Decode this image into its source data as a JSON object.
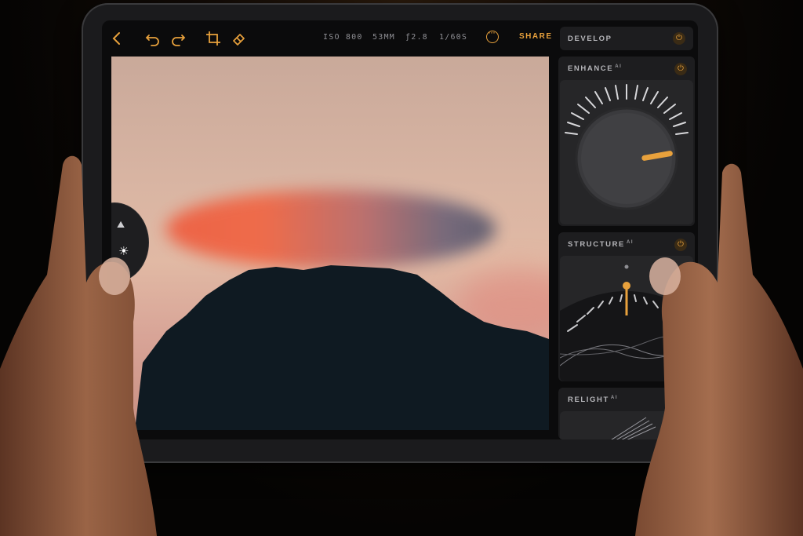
{
  "toolbar": {
    "back_icon": "chevron-left-icon",
    "undo_icon": "undo-icon",
    "redo_icon": "redo-icon",
    "crop_icon": "crop-icon",
    "eraser_icon": "eraser-icon",
    "iso": "ISO 800",
    "focal": "53MM",
    "aperture": "ƒ2.8",
    "shutter": "1/60S",
    "more_icon": "more-icon",
    "share_label": "SHARE"
  },
  "panel": {
    "develop_label": "DEVELOP",
    "cards": [
      {
        "title": "ENHANCE",
        "badge": "AI"
      },
      {
        "title": "STRUCTURE",
        "badge": "AI"
      },
      {
        "title": "RELIGHT",
        "badge": "AI"
      }
    ]
  },
  "colors": {
    "accent": "#e8a13c",
    "panel": "#1d1d1f"
  }
}
